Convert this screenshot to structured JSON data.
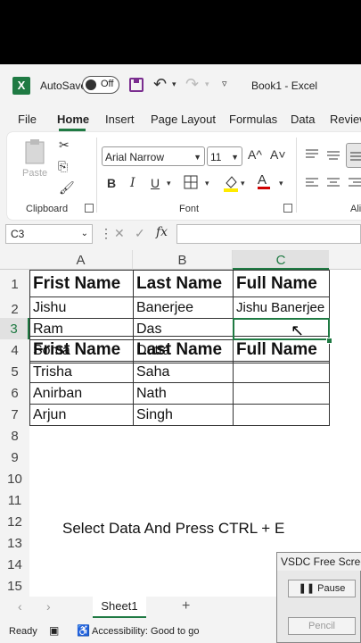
{
  "titlebar": {
    "logo": "X",
    "autosave_label": "AutoSave",
    "toggle_state": "Off",
    "book_title": "Book1  -  Excel"
  },
  "tabs": [
    "File",
    "Home",
    "Insert",
    "Page Layout",
    "Formulas",
    "Data",
    "Review"
  ],
  "active_tab": "Home",
  "ribbon": {
    "paste_label": "Paste",
    "clipboard_label": "Clipboard",
    "font_name": "Arial Narrow",
    "font_size": "11",
    "font_label": "Font",
    "alignment_label_partial": "Ali",
    "bold": "B",
    "italic": "I",
    "underline": "U",
    "grow_font": "A^",
    "shrink_font": "A˅",
    "font_color_letter": "A"
  },
  "formula_bar": {
    "name_box": "C3",
    "fx": "fx",
    "value": ""
  },
  "grid": {
    "columns": [
      "A",
      "B",
      "C"
    ],
    "rows": [
      "1",
      "2",
      "3",
      "4",
      "5",
      "6",
      "7",
      "8",
      "9",
      "10",
      "11",
      "12",
      "13",
      "14",
      "15"
    ],
    "headers": [
      "Frist Name",
      "Last Name",
      "Full Name"
    ],
    "data": [
      [
        "Jishu",
        "Banerjee",
        "Jishu Banerjee"
      ],
      [
        "Ram",
        "Das",
        ""
      ],
      [
        "Soma",
        "Dutta",
        ""
      ],
      [
        "Trisha",
        "Saha",
        ""
      ],
      [
        "Anirban",
        "Nath",
        ""
      ],
      [
        "Arjun",
        "Singh",
        ""
      ]
    ],
    "note": "Select Data And Press CTRL + E",
    "selected_cell": "C3"
  },
  "sheets": {
    "active": "Sheet1",
    "add": "+"
  },
  "status": {
    "ready": "Ready",
    "accessibility": "Accessibility: Good to go"
  },
  "vsdc": {
    "title": "VSDC Free Screen Recorder",
    "pause": "Pause",
    "pencil": "Pencil"
  }
}
